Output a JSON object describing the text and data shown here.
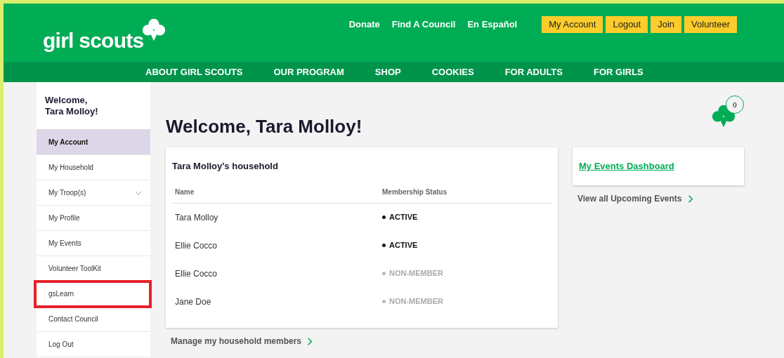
{
  "header": {
    "logo_text": "girl scouts",
    "utility_links": [
      "Donate",
      "Find A Council",
      "En Español"
    ],
    "buttons": [
      "My Account",
      "Logout",
      "Join",
      "Volunteer"
    ]
  },
  "nav": [
    "ABOUT GIRL SCOUTS",
    "OUR PROGRAM",
    "SHOP",
    "COOKIES",
    "FOR ADULTS",
    "FOR GIRLS"
  ],
  "sidebar": {
    "greeting": "Welcome,\nTara Molloy!",
    "items": [
      {
        "label": "My Account",
        "selected": true,
        "expandable": false,
        "highlighted": false
      },
      {
        "label": "My Household",
        "selected": false,
        "expandable": false,
        "highlighted": false
      },
      {
        "label": "My Troop(s)",
        "selected": false,
        "expandable": true,
        "highlighted": false
      },
      {
        "label": "My Profile",
        "selected": false,
        "expandable": false,
        "highlighted": false
      },
      {
        "label": "My Events",
        "selected": false,
        "expandable": false,
        "highlighted": false
      },
      {
        "label": "Volunteer ToolKit",
        "selected": false,
        "expandable": false,
        "highlighted": false
      },
      {
        "label": "gsLearn",
        "selected": false,
        "expandable": false,
        "highlighted": true
      },
      {
        "label": "Contact Council",
        "selected": false,
        "expandable": false,
        "highlighted": false
      },
      {
        "label": "Log Out",
        "selected": false,
        "expandable": false,
        "highlighted": false
      }
    ]
  },
  "main": {
    "title": "Welcome, Tara Molloy!",
    "cart_count": "0",
    "household": {
      "title": "Tara Molloy's household",
      "columns": [
        "Name",
        "Membership Status"
      ],
      "rows": [
        {
          "name": "Tara Molloy",
          "status": "ACTIVE",
          "active": true
        },
        {
          "name": "Ellie Cocco",
          "status": "ACTIVE",
          "active": true
        },
        {
          "name": "Ellie Cocco",
          "status": "NON-MEMBER",
          "active": false
        },
        {
          "name": "Jane Doe",
          "status": "NON-MEMBER",
          "active": false
        }
      ],
      "manage_link": "Manage my household members"
    },
    "events": {
      "title": "My Events Dashboard",
      "link": "View all Upcoming Events"
    }
  }
}
